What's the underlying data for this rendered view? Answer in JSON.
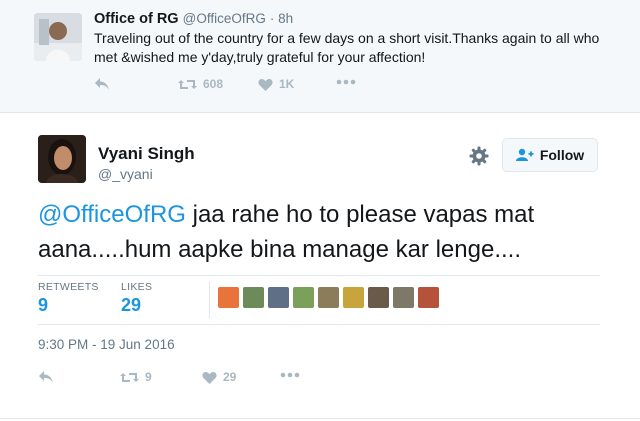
{
  "parent_tweet": {
    "name": "Office of RG",
    "handle": "@OfficeOfRG",
    "time": "· 8h",
    "text": "Traveling out of the country for a few days on a short visit.Thanks again to all who met &wished me y'day,truly grateful for your affection!",
    "retweets": "608",
    "likes": "1K",
    "icons": {
      "reply": "reply-icon",
      "retweet": "retweet-icon",
      "like": "heart-icon",
      "more": "more-icon"
    }
  },
  "main_tweet": {
    "name": "Vyani Singh",
    "handle": "@_vyani",
    "follow_label": "Follow",
    "mention": "@OfficeOfRG",
    "text_rest": " jaa rahe ho to please vapas mat aana.....hum aapke bina manage kar lenge....",
    "stats": {
      "retweets_label": "RETWEETS",
      "retweets_value": "9",
      "likes_label": "LIKES",
      "likes_value": "29"
    },
    "timestamp": "9:30 PM - 19 Jun 2016",
    "action_retweets": "9",
    "action_likes": "29",
    "liker_colors": [
      "#e8743b",
      "#6d8a5a",
      "#5e6f86",
      "#7aa05a",
      "#8b7d5a",
      "#c7a43c",
      "#6a5a4a",
      "#7d7868",
      "#b5523a"
    ]
  },
  "colors": {
    "accent": "#1b95e0",
    "muted": "#657786",
    "icon": "#aab8c2"
  }
}
